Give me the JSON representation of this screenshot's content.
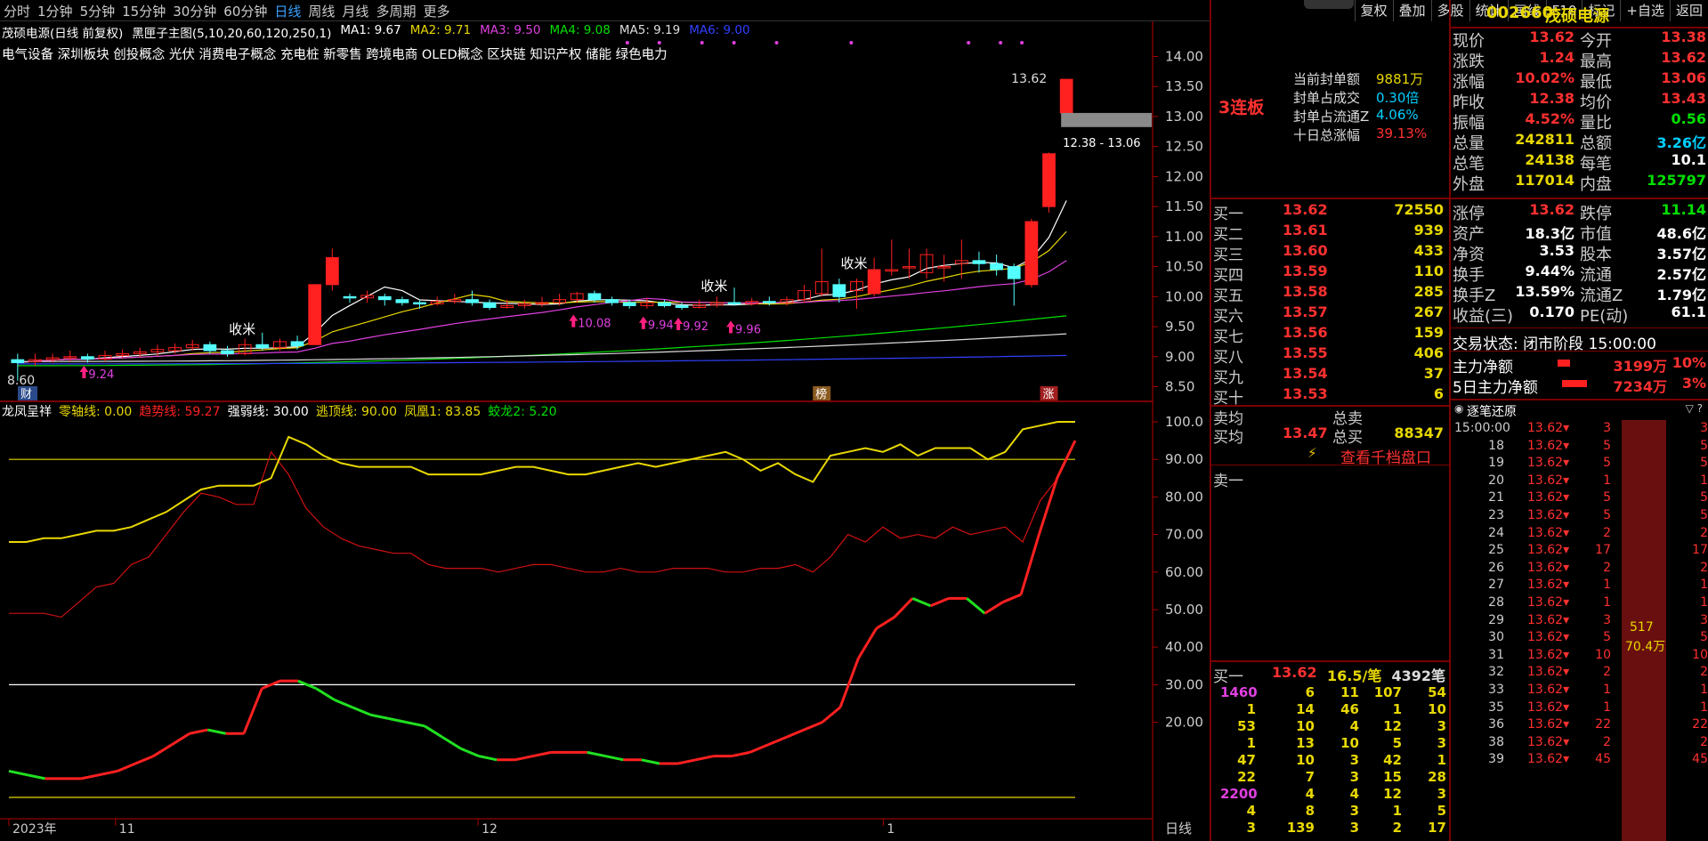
{
  "periods": [
    "分时",
    "1分钟",
    "5分钟",
    "15分钟",
    "30分钟",
    "60分钟",
    "日线",
    "周线",
    "月线",
    "多周期",
    "更多"
  ],
  "active_period": "日线",
  "tools": [
    "复权",
    "叠加",
    "多股",
    "统计",
    "画线",
    "F10",
    "标记",
    "+自选",
    "返回"
  ],
  "title": "茂硕电源(日线 前复权)",
  "main_indicator": "黑匣子主图(5,10,20,60,120,250,1)",
  "ma": [
    {
      "label": "MA1: 9.67",
      "color": "#ffffff"
    },
    {
      "label": "MA2: 9.71",
      "color": "#e8d800"
    },
    {
      "label": "MA3: 9.50",
      "color": "#e040e0"
    },
    {
      "label": "MA4: 9.08",
      "color": "#00e000"
    },
    {
      "label": "MA5: 9.19",
      "color": "#dddddd"
    },
    {
      "label": "MA6: 9.00",
      "color": "#3040ff"
    }
  ],
  "concepts": "电气设备 深圳板块 创投概念 光伏 消费电子概念 充电桩 新零售 跨境电商 OLED概念 区块链 知识产权 储能 绿色电力",
  "price_axis": [
    "14.00",
    "13.50",
    "13.00",
    "12.50",
    "12.00",
    "11.50",
    "11.00",
    "10.50",
    "10.00",
    "9.50",
    "9.00",
    "8.50"
  ],
  "ind_axis": [
    "100.0",
    "90.00",
    "80.00",
    "70.00",
    "60.00",
    "50.00",
    "40.00",
    "30.00",
    "20.00"
  ],
  "chart_labels": {
    "high": "13.62",
    "low": "8.60",
    "range": "12.38 - 13.06",
    "shoumi": "收米",
    "caibu": "财",
    "bang": "榜",
    "zhang": "涨"
  },
  "arrow_labels": [
    "9.24",
    "10.08",
    "9.94",
    "9.92",
    "9.96"
  ],
  "indicator": {
    "name": "龙凤呈祥",
    "items": [
      {
        "label": "零轴线: 0.00",
        "color": "#e8d800"
      },
      {
        "label": "趋势线: 59.27",
        "color": "#ff2020"
      },
      {
        "label": "强弱线: 30.00",
        "color": "#ffffff"
      },
      {
        "label": "逃顶线: 90.00",
        "color": "#e8d800"
      },
      {
        "label": "凤凰1: 83.85",
        "color": "#e8d800"
      },
      {
        "label": "蛟龙2: 5.20",
        "color": "#00e000"
      }
    ]
  },
  "date_axis": [
    "2023年",
    "11",
    "12",
    "1"
  ],
  "period_label": "日线",
  "chart_data": {
    "type": "candlestick",
    "price_ylim": [
      8.3,
      14.2
    ],
    "candles": [
      [
        8.95,
        8.9,
        9.05,
        8.6
      ],
      [
        8.92,
        8.95,
        9.05,
        8.85
      ],
      [
        8.95,
        8.98,
        9.05,
        8.9
      ],
      [
        8.98,
        9.0,
        9.1,
        8.92
      ],
      [
        9.0,
        8.96,
        9.05,
        8.9
      ],
      [
        8.96,
        9.02,
        9.1,
        8.92
      ],
      [
        9.02,
        9.05,
        9.12,
        8.98
      ],
      [
        9.05,
        9.08,
        9.15,
        9.0
      ],
      [
        9.08,
        9.12,
        9.2,
        9.02
      ],
      [
        9.1,
        9.15,
        9.22,
        9.05
      ],
      [
        9.15,
        9.2,
        9.28,
        9.1
      ],
      [
        9.2,
        9.1,
        9.25,
        9.05
      ],
      [
        9.1,
        9.05,
        9.18,
        9.0
      ],
      [
        9.05,
        9.2,
        9.3,
        9.02
      ],
      [
        9.2,
        9.15,
        9.4,
        9.1
      ],
      [
        9.15,
        9.25,
        9.3,
        9.1
      ],
      [
        9.25,
        9.18,
        9.35,
        9.12
      ],
      [
        9.2,
        10.2,
        10.2,
        9.2
      ],
      [
        10.2,
        10.65,
        10.8,
        10.1
      ],
      [
        10.0,
        9.98,
        10.05,
        9.9
      ],
      [
        9.98,
        10.02,
        10.1,
        9.9
      ],
      [
        10.0,
        9.95,
        10.05,
        9.85
      ],
      [
        9.95,
        9.9,
        10.0,
        9.85
      ],
      [
        9.9,
        9.88,
        9.95,
        9.8
      ],
      [
        9.88,
        9.92,
        10.0,
        9.85
      ],
      [
        9.92,
        9.95,
        10.05,
        9.88
      ],
      [
        9.95,
        9.9,
        10.1,
        9.85
      ],
      [
        9.9,
        9.82,
        9.95,
        9.78
      ],
      [
        9.82,
        9.85,
        9.95,
        9.8
      ],
      [
        9.85,
        9.88,
        9.95,
        9.8
      ],
      [
        9.88,
        9.9,
        10.0,
        9.83
      ],
      [
        9.9,
        9.95,
        10.05,
        9.85
      ],
      [
        9.95,
        10.05,
        10.08,
        9.9
      ],
      [
        10.05,
        9.95,
        10.1,
        9.9
      ],
      [
        9.95,
        9.9,
        10.0,
        9.85
      ],
      [
        9.9,
        9.85,
        9.95,
        9.8
      ],
      [
        9.85,
        9.9,
        9.98,
        9.8
      ],
      [
        9.9,
        9.85,
        9.95,
        9.82
      ],
      [
        9.85,
        9.82,
        9.9,
        9.78
      ],
      [
        9.82,
        9.86,
        9.95,
        9.8
      ],
      [
        9.86,
        9.9,
        10.0,
        9.82
      ],
      [
        9.9,
        9.88,
        10.15,
        9.85
      ],
      [
        9.88,
        9.92,
        9.98,
        9.85
      ],
      [
        9.92,
        9.9,
        10.0,
        9.85
      ],
      [
        9.9,
        9.95,
        10.0,
        9.85
      ],
      [
        9.95,
        10.1,
        10.2,
        9.9
      ],
      [
        10.05,
        10.25,
        10.8,
        10.0
      ],
      [
        10.2,
        10.0,
        10.3,
        9.9
      ],
      [
        10.1,
        10.25,
        10.3,
        9.8
      ],
      [
        10.05,
        10.45,
        10.65,
        10.0
      ],
      [
        10.45,
        10.45,
        10.95,
        10.35
      ],
      [
        10.5,
        10.5,
        10.8,
        10.3
      ],
      [
        10.4,
        10.7,
        10.8,
        10.3
      ],
      [
        10.5,
        10.5,
        10.7,
        10.25
      ],
      [
        10.55,
        10.6,
        10.95,
        10.3
      ],
      [
        10.6,
        10.55,
        10.75,
        10.4
      ],
      [
        10.55,
        10.45,
        10.7,
        10.35
      ],
      [
        10.5,
        10.3,
        10.55,
        9.85
      ],
      [
        10.2,
        11.25,
        11.3,
        10.15
      ],
      [
        11.5,
        12.38,
        12.4,
        11.4
      ],
      [
        13.06,
        13.62,
        13.62,
        12.9
      ]
    ],
    "ind_ylim": [
      0,
      100
    ],
    "trend_line": [
      49,
      49,
      49,
      48,
      52,
      56,
      57,
      62,
      64,
      70,
      76,
      81,
      80,
      78,
      78,
      92,
      86,
      77,
      72,
      69,
      67,
      66,
      65,
      65,
      62,
      61,
      61,
      61,
      60,
      61,
      62,
      62,
      61,
      60,
      60,
      61,
      60,
      60,
      61,
      61,
      61,
      60,
      60,
      61,
      61,
      62,
      60,
      64,
      70,
      68,
      72,
      69,
      70,
      69,
      72,
      70,
      71,
      72,
      68,
      79,
      85,
      95
    ],
    "phoenix_line": [
      68,
      68,
      69,
      69,
      70,
      71,
      71,
      72,
      74,
      76,
      79,
      82,
      83,
      83,
      83,
      85,
      96,
      94,
      91,
      89,
      88,
      88,
      88,
      88,
      86,
      86,
      86,
      86,
      87,
      88,
      88,
      87,
      86,
      86,
      87,
      88,
      89,
      88,
      89,
      90,
      91,
      92,
      90,
      87,
      89,
      86,
      84,
      91,
      92,
      93,
      92,
      94,
      91,
      93,
      93,
      93,
      90,
      92,
      98,
      99,
      100,
      100
    ],
    "dragon_line": [
      7,
      6,
      5,
      5,
      5,
      6,
      7,
      9,
      11,
      14,
      17,
      18,
      17,
      17,
      29,
      31,
      31,
      29,
      26,
      24,
      22,
      21,
      20,
      19,
      16,
      13,
      11,
      10,
      10,
      11,
      12,
      12,
      12,
      11,
      10,
      10,
      9,
      9,
      10,
      11,
      11,
      12,
      14,
      16,
      18,
      20,
      24,
      37,
      45,
      48,
      53,
      51,
      53,
      53,
      49,
      52,
      54,
      70,
      85,
      95
    ]
  },
  "mid": {
    "lianban": "3连板",
    "seal": [
      {
        "k": "当前封单额",
        "v": "9881万",
        "c": "yel"
      },
      {
        "k": "封单占成交",
        "v": "0.30倍",
        "c": "cyan"
      },
      {
        "k": "封单占流通Z",
        "v": "4.06%",
        "c": "cyan"
      },
      {
        "k": "十日总涨幅",
        "v": "39.13%",
        "c": "red"
      }
    ],
    "bids": [
      [
        "买一",
        "13.62",
        "72550"
      ],
      [
        "买二",
        "13.61",
        "939"
      ],
      [
        "买三",
        "13.60",
        "433"
      ],
      [
        "买四",
        "13.59",
        "110"
      ],
      [
        "买五",
        "13.58",
        "285"
      ],
      [
        "买六",
        "13.57",
        "267"
      ],
      [
        "买七",
        "13.56",
        "159"
      ],
      [
        "买八",
        "13.55",
        "406"
      ],
      [
        "买九",
        "13.54",
        "37"
      ],
      [
        "买十",
        "13.53",
        "6"
      ]
    ],
    "avg": [
      [
        "卖均",
        "",
        "总卖",
        ""
      ],
      [
        "买均",
        "13.47",
        "总买",
        "88347"
      ]
    ],
    "qiandang": "查看千档盘口",
    "sell1": "卖一",
    "queue_head": {
      "k": "买一",
      "price": "13.62",
      "avg": "16.5/笔",
      "cnt": "4392笔"
    },
    "queue": [
      [
        "1460",
        "6",
        "11",
        "107",
        "54"
      ],
      [
        "1",
        "14",
        "46",
        "1",
        "10"
      ],
      [
        "53",
        "10",
        "4",
        "12",
        "3"
      ],
      [
        "1",
        "13",
        "10",
        "5",
        "3"
      ],
      [
        "47",
        "10",
        "3",
        "42",
        "1"
      ],
      [
        "22",
        "7",
        "3",
        "15",
        "28"
      ],
      [
        "2200",
        "4",
        "4",
        "12",
        "3"
      ],
      [
        "4",
        "8",
        "3",
        "1",
        "5"
      ],
      [
        "3",
        "139",
        "3",
        "2",
        "17"
      ]
    ]
  },
  "right": {
    "code": "002660",
    "name": "茂硕电源",
    "quote": [
      [
        "现价",
        "13.62",
        "今开",
        "13.38"
      ],
      [
        "涨跌",
        "1.24",
        "最高",
        "13.62"
      ],
      [
        "涨幅",
        "10.02%",
        "最低",
        "13.06"
      ],
      [
        "昨收",
        "12.38",
        "均价",
        "13.43"
      ],
      [
        "振幅",
        "4.52%",
        "量比",
        "0.56"
      ],
      [
        "总量",
        "242811",
        "总额",
        "3.26亿"
      ],
      [
        "总笔",
        "24138",
        "每笔",
        "10.1"
      ],
      [
        "外盘",
        "117014",
        "内盘",
        "125797"
      ]
    ],
    "fin": [
      [
        "涨停",
        "13.62",
        "跌停",
        "11.14"
      ],
      [
        "资产",
        "18.3亿",
        "市值",
        "48.6亿"
      ],
      [
        "净资",
        "3.53",
        "股本",
        "3.57亿"
      ],
      [
        "换手",
        "9.44%",
        "流通",
        "2.57亿"
      ],
      [
        "换手Z",
        "13.59%",
        "流通Z",
        "1.79亿"
      ],
      [
        "收益(三)",
        "0.170",
        "PE(动)",
        "61.1"
      ]
    ],
    "status": "交易状态: 闭市阶段 15:00:00",
    "flow": [
      [
        "主力净额",
        "3199万",
        "10%"
      ],
      [
        "5日主力净额",
        "7234万",
        "3%"
      ]
    ],
    "ticks_title": "逐笔还原",
    "ticks": [
      [
        "15:00:00",
        "13.62",
        "3",
        "3"
      ],
      [
        "18",
        "13.62",
        "5",
        "5"
      ],
      [
        "19",
        "13.62",
        "5",
        "5"
      ],
      [
        "20",
        "13.62",
        "1",
        "1"
      ],
      [
        "21",
        "13.62",
        "5",
        "5"
      ],
      [
        "23",
        "13.62",
        "5",
        "5"
      ],
      [
        "24",
        "13.62",
        "2",
        "2"
      ],
      [
        "25",
        "13.62",
        "17",
        "17"
      ],
      [
        "26",
        "13.62",
        "2",
        "2"
      ],
      [
        "27",
        "13.62",
        "1",
        "1"
      ],
      [
        "28",
        "13.62",
        "1",
        "1"
      ],
      [
        "29",
        "13.62",
        "3",
        "3"
      ],
      [
        "30",
        "13.62",
        "5",
        "5"
      ],
      [
        "31",
        "13.62",
        "10",
        "10"
      ],
      [
        "32",
        "13.62",
        "2",
        "2"
      ],
      [
        "33",
        "13.62",
        "1",
        "1"
      ],
      [
        "35",
        "13.62",
        "1",
        "1"
      ],
      [
        "36",
        "13.62",
        "22",
        "22"
      ],
      [
        "38",
        "13.62",
        "2",
        "2"
      ],
      [
        "39",
        "13.62",
        "45",
        "45"
      ]
    ],
    "big_order": "517",
    "big_amount": "70.4万"
  }
}
